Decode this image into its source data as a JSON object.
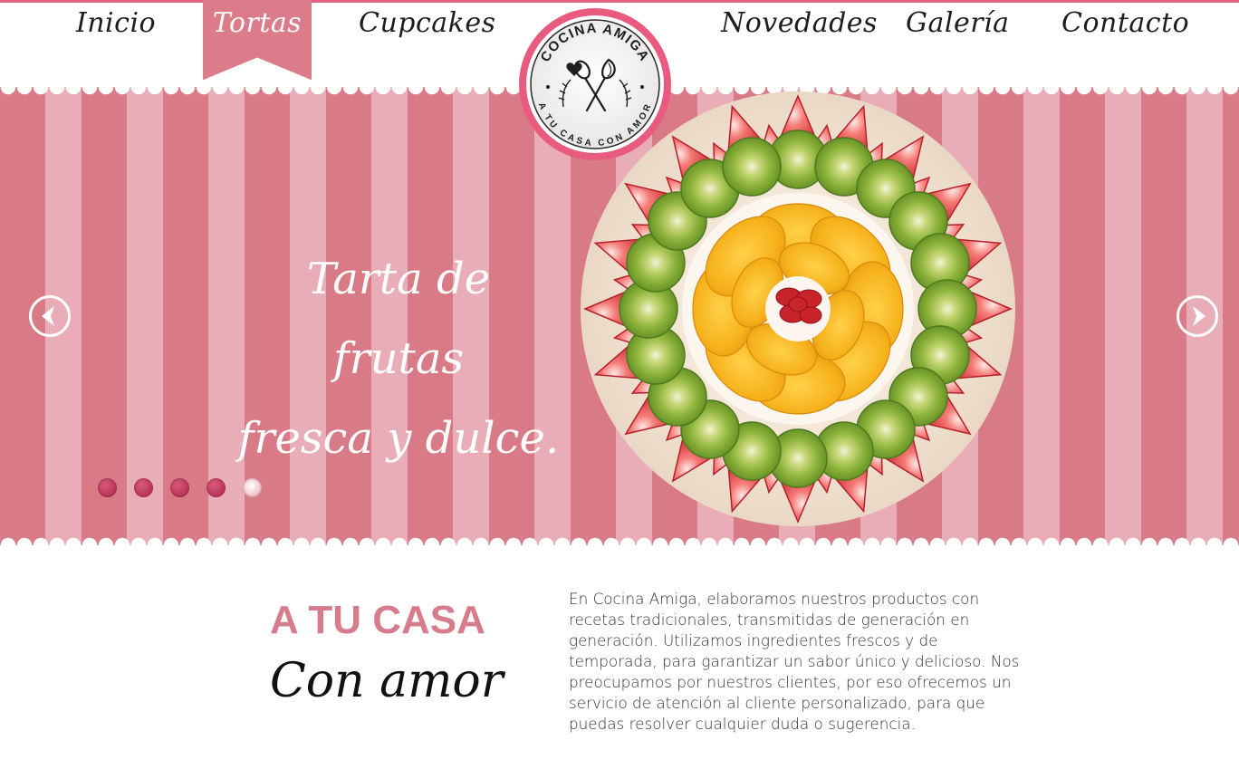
{
  "nav": {
    "items": [
      {
        "label": "Inicio"
      },
      {
        "label": "Tortas",
        "active": true
      },
      {
        "label": "Cupcakes"
      },
      {
        "label": "Novedades"
      },
      {
        "label": "Galería"
      },
      {
        "label": "Contacto"
      }
    ]
  },
  "logo": {
    "top_text": "COCINA AMIGA",
    "bottom_text": "A TU CASA CON AMOR"
  },
  "hero": {
    "title_line1": "Tarta de frutas",
    "title_line2": "fresca y dulce.",
    "prev_icon": "chevron-left-icon",
    "next_icon": "chevron-right-icon",
    "slide_count": 5,
    "active_slide": 5
  },
  "about": {
    "title": "A TU CASA",
    "subtitle": "Con amor",
    "body": "En Cocina Amiga, elaboramos nuestros productos con recetas tradicionales, transmitidas de generación en generación. Utilizamos ingredientes frescos y de temporada, para garantizar un sabor único y delicioso. Nos preocupamos por nuestros clientes, por eso ofrecemos un servicio de atención al cliente personalizado, para que puedas resolver cualquier duda o sugerencia."
  },
  "colors": {
    "accent": "#e2647f",
    "stripe_dark": "#d97a87",
    "stripe_light": "#e8adb7",
    "title_pink": "#d77c8b"
  }
}
